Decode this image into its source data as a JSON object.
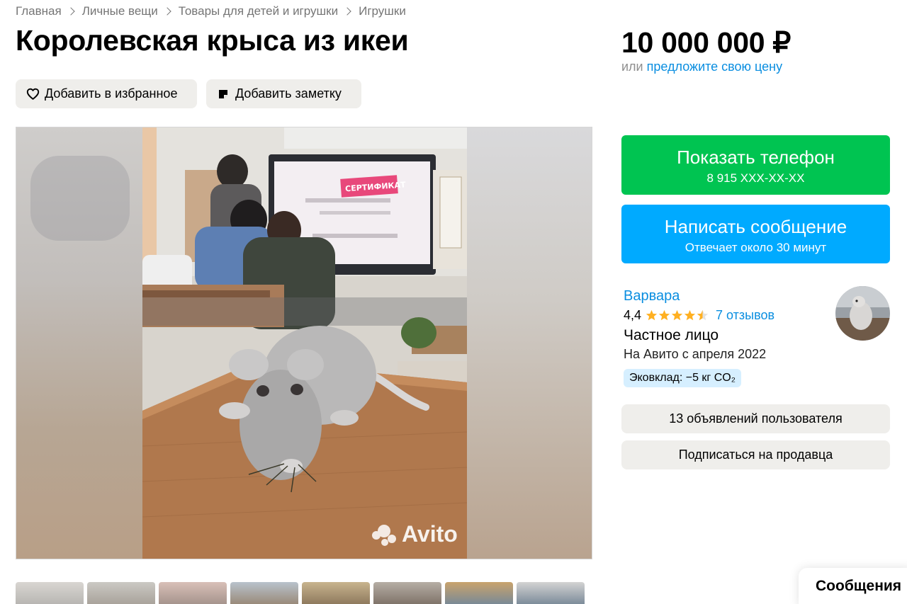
{
  "breadcrumb": [
    "Главная",
    "Личные вещи",
    "Товары для детей и игрушки",
    "Игрушки"
  ],
  "title": "Королевская крыса из икеи",
  "actions": {
    "favorite_label": "Добавить в избранное",
    "note_label": "Добавить заметку"
  },
  "gallery": {
    "watermark": "Avito",
    "thumbnail_count": 8
  },
  "price": {
    "value": "10 000 000 ₽",
    "or_text": "или",
    "offer_link": "предложите свою цену"
  },
  "contact": {
    "phone_label": "Показать телефон",
    "phone_masked": "8 915 XXX-XX-XX",
    "message_label": "Написать сообщение",
    "message_sub": "Отвечает около 30 минут"
  },
  "seller": {
    "name": "Варвара",
    "rating": "4,4",
    "rating_value": 4.4,
    "reviews": "7 отзывов",
    "type": "Частное лицо",
    "since": "На Авито с апреля 2022",
    "eco_badge": "Эковклад: −5 кг CO₂"
  },
  "seller_actions": {
    "listings": "13 объявлений пользователя",
    "subscribe": "Подписаться на продавца"
  },
  "messages_tab": "Сообщения",
  "colors": {
    "green": "#00c451",
    "blue": "#00aaff",
    "link": "#0a8ee0",
    "star": "#ffb021",
    "grey_button": "#efeeeb"
  }
}
